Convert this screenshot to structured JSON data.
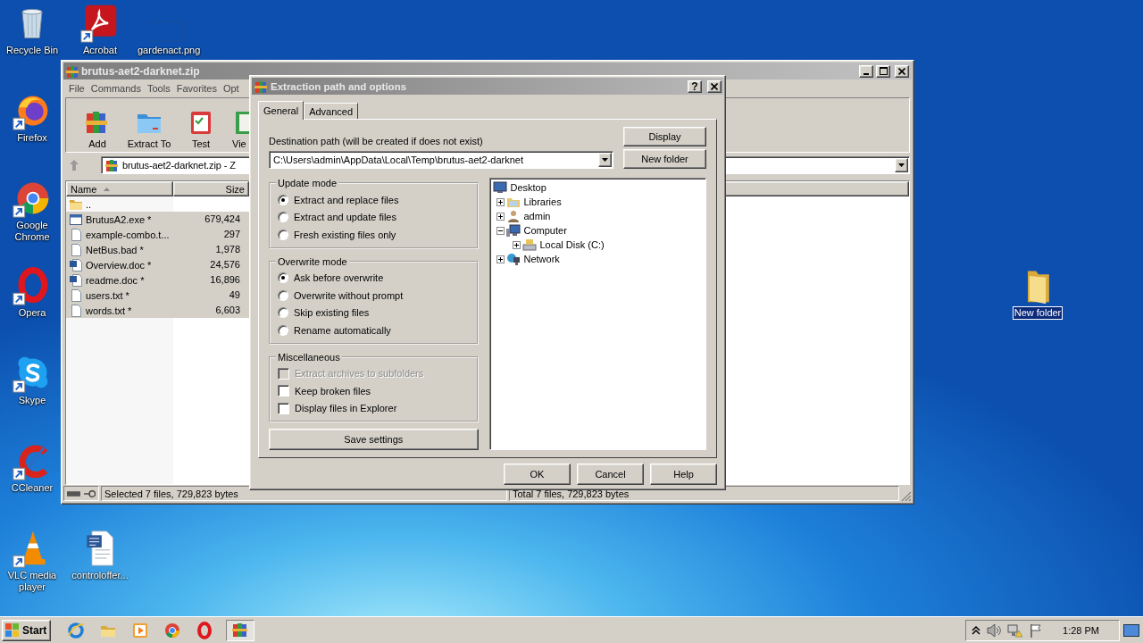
{
  "desktop_icons": [
    {
      "label": "Recycle Bin",
      "kind": "recycle-bin",
      "shortcut": false,
      "selected": false
    },
    {
      "label": "Acrobat",
      "kind": "acrobat",
      "shortcut": true,
      "selected": false
    },
    {
      "label": "gardenact.png",
      "kind": "image-file",
      "shortcut": false,
      "selected": false
    },
    {
      "label": "Firefox",
      "kind": "firefox",
      "shortcut": true,
      "selected": false
    },
    {
      "label": "Google Chrome",
      "kind": "chrome",
      "shortcut": true,
      "selected": false
    },
    {
      "label": "Opera",
      "kind": "opera",
      "shortcut": true,
      "selected": false
    },
    {
      "label": "Skype",
      "kind": "skype",
      "shortcut": true,
      "selected": false
    },
    {
      "label": "CCleaner",
      "kind": "ccleaner",
      "shortcut": true,
      "selected": false
    },
    {
      "label": "VLC media player",
      "kind": "vlc",
      "shortcut": true,
      "selected": false
    },
    {
      "label": "controloffer...",
      "kind": "word-doc",
      "shortcut": false,
      "selected": false
    },
    {
      "label": "New folder",
      "kind": "folder",
      "shortcut": false,
      "selected": true
    }
  ],
  "winrar": {
    "title": "brutus-aet2-darknet.zip",
    "menu": [
      "File",
      "Commands",
      "Tools",
      "Favorites",
      "Opt"
    ],
    "toolbar": [
      {
        "label": "Add",
        "kind": "add"
      },
      {
        "label": "Extract To",
        "kind": "extract"
      },
      {
        "label": "Test",
        "kind": "test"
      },
      {
        "label": "Vie",
        "kind": "view"
      }
    ],
    "address": "brutus-aet2-darknet.zip - Z",
    "columns": [
      "Name",
      "Size"
    ],
    "files": [
      {
        "name": "..",
        "kind": "folder",
        "selected": false
      },
      {
        "name": "BrutusA2.exe *",
        "size": "679,424",
        "kind": "exe",
        "selected": true
      },
      {
        "name": "example-combo.t...",
        "size": "297",
        "kind": "text",
        "selected": true
      },
      {
        "name": "NetBus.bad *",
        "size": "1,978",
        "kind": "text",
        "selected": true
      },
      {
        "name": "Overview.doc *",
        "size": "24,576",
        "kind": "doc",
        "selected": true
      },
      {
        "name": "readme.doc *",
        "size": "16,896",
        "kind": "doc",
        "selected": true
      },
      {
        "name": "users.txt *",
        "size": "49",
        "kind": "text",
        "selected": true
      },
      {
        "name": "words.txt *",
        "size": "6,603",
        "kind": "text",
        "selected": true
      }
    ],
    "status_left": "Selected 7 files, 729,823 bytes",
    "status_right": "Total 7 files, 729,823 bytes"
  },
  "dialog": {
    "title": "Extraction path and options",
    "help_button": "?",
    "tabs": [
      {
        "label": "General",
        "selected": true
      },
      {
        "label": "Advanced",
        "selected": false
      }
    ],
    "destination_label": "Destination path (will be created if does not exist)",
    "destination_path": "C:\\Users\\admin\\AppData\\Local\\Temp\\brutus-aet2-darknet",
    "side_buttons": [
      "Display",
      "New folder"
    ],
    "groups": [
      {
        "title": "Update mode",
        "options": [
          {
            "label": "Extract and replace files",
            "kind": "radio",
            "selected": true
          },
          {
            "label": "Extract and update files",
            "kind": "radio",
            "selected": false
          },
          {
            "label": "Fresh existing files only",
            "kind": "radio",
            "selected": false
          }
        ]
      },
      {
        "title": "Overwrite mode",
        "options": [
          {
            "label": "Ask before overwrite",
            "kind": "radio",
            "selected": true
          },
          {
            "label": "Overwrite without prompt",
            "kind": "radio",
            "selected": false
          },
          {
            "label": "Skip existing files",
            "kind": "radio",
            "selected": false
          },
          {
            "label": "Rename automatically",
            "kind": "radio",
            "selected": false
          }
        ]
      },
      {
        "title": "Miscellaneous",
        "options": [
          {
            "label": "Extract archives to subfolders",
            "kind": "checkbox",
            "checked": false,
            "disabled": true
          },
          {
            "label": "Keep broken files",
            "kind": "checkbox",
            "checked": false,
            "disabled": false
          },
          {
            "label": "Display files in Explorer",
            "kind": "checkbox",
            "checked": false,
            "disabled": false
          }
        ]
      }
    ],
    "save_button": "Save settings",
    "tree": [
      {
        "label": "Desktop",
        "kind": "desktop",
        "children": [
          {
            "label": "Libraries",
            "kind": "libraries",
            "expanded": false
          },
          {
            "label": "admin",
            "kind": "user",
            "expanded": false
          },
          {
            "label": "Computer",
            "kind": "computer",
            "expanded": true,
            "children": [
              {
                "label": "Local Disk (C:)",
                "kind": "disk",
                "expanded": false
              }
            ]
          },
          {
            "label": "Network",
            "kind": "network",
            "expanded": false
          }
        ]
      }
    ],
    "footer_buttons": [
      "OK",
      "Cancel",
      "Help"
    ]
  },
  "taskbar": {
    "start": "Start",
    "apps": [
      {
        "kind": "ie",
        "selected": false
      },
      {
        "kind": "explorer",
        "selected": false
      },
      {
        "kind": "media",
        "selected": false
      },
      {
        "kind": "chrome",
        "selected": false
      },
      {
        "kind": "opera",
        "selected": false
      },
      {
        "kind": "winrar",
        "selected": true
      }
    ],
    "clock": "1:28 PM"
  }
}
